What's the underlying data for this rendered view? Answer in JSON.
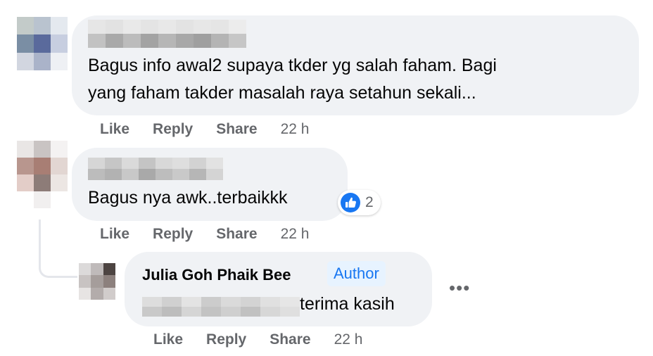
{
  "colors": {
    "bubble_bg": "#f0f2f5",
    "secondary_text": "#65676b",
    "like_blue": "#1877f2",
    "author_badge_bg": "#e7f3ff",
    "thread_line": "#e4e6eb"
  },
  "comments": [
    {
      "text_line1": "Bagus info awal2 supaya tkder yg salah faham. Bagi",
      "text_line2": "yang faham takder masalah raya setahun sekali...",
      "actions": {
        "like": "Like",
        "reply": "Reply",
        "share": "Share",
        "time": "22 h"
      }
    },
    {
      "text": "Bagus nya awk..terbaikkk",
      "reaction": {
        "icon": "thumbs-up-icon",
        "count": "2"
      },
      "actions": {
        "like": "Like",
        "reply": "Reply",
        "share": "Share",
        "time": "22 h"
      }
    }
  ],
  "reply": {
    "author": "Julia Goh Phaik Bee",
    "badge": "Author",
    "text": "terima kasih",
    "more_icon": "more-options-icon",
    "actions": {
      "like": "Like",
      "reply": "Reply",
      "share": "Share",
      "time": "22 h"
    }
  }
}
